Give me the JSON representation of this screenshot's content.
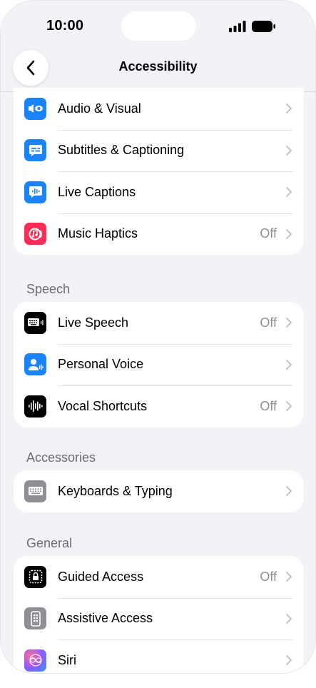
{
  "status": {
    "time": "10:00"
  },
  "nav": {
    "title": "Accessibility"
  },
  "groups": {
    "hearing": {
      "items": [
        {
          "label": "Audio & Visual",
          "value": "",
          "icon": "speaker-eye-icon",
          "color": "#1a84ff"
        },
        {
          "label": "Subtitles & Captioning",
          "value": "",
          "icon": "captions-bubble-icon",
          "color": "#1a84ff"
        },
        {
          "label": "Live Captions",
          "value": "",
          "icon": "waveform-bubble-icon",
          "color": "#1a84ff"
        },
        {
          "label": "Music Haptics",
          "value": "Off",
          "icon": "music-haptics-icon",
          "color": "#ff2d55"
        }
      ]
    },
    "speech": {
      "header": "Speech",
      "items": [
        {
          "label": "Live Speech",
          "value": "Off",
          "icon": "keyboard-wave-icon",
          "color": "#000000"
        },
        {
          "label": "Personal Voice",
          "value": "",
          "icon": "person-wave-icon",
          "color": "#1a84ff"
        },
        {
          "label": "Vocal Shortcuts",
          "value": "Off",
          "icon": "waveform-icon",
          "color": "#000000"
        }
      ]
    },
    "accessories": {
      "header": "Accessories",
      "items": [
        {
          "label": "Keyboards & Typing",
          "value": "",
          "icon": "keyboard-icon",
          "color": "#8e8e93"
        }
      ]
    },
    "general": {
      "header": "General",
      "items": [
        {
          "label": "Guided Access",
          "value": "Off",
          "icon": "lock-frame-icon",
          "color": "#000000"
        },
        {
          "label": "Assistive Access",
          "value": "",
          "icon": "phone-grid-icon",
          "color": "#8e8e93"
        },
        {
          "label": "Siri",
          "value": "",
          "icon": "siri-icon",
          "color": "#6a5cff"
        }
      ]
    }
  }
}
